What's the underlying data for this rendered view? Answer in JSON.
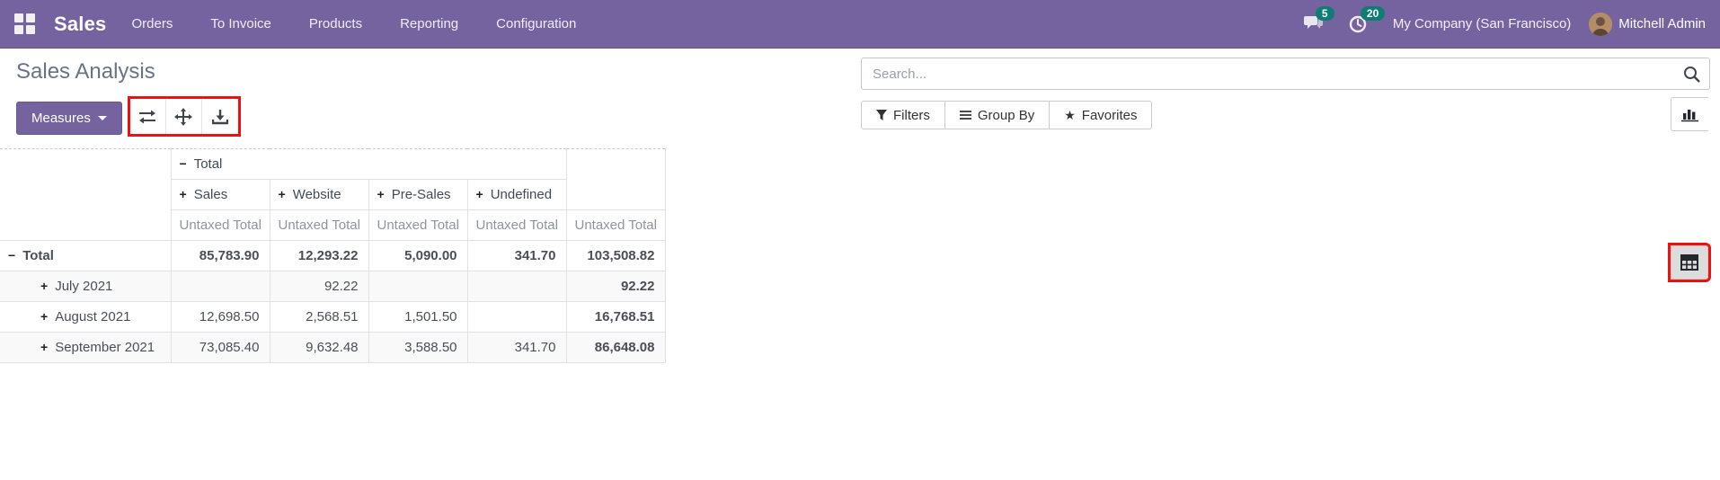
{
  "navbar": {
    "brand": "Sales",
    "menu": [
      "Orders",
      "To Invoice",
      "Products",
      "Reporting",
      "Configuration"
    ],
    "messages_badge": "5",
    "activities_badge": "20",
    "company": "My Company (San Francisco)",
    "user": "Mitchell Admin"
  },
  "page": {
    "title": "Sales Analysis",
    "measures_label": "Measures"
  },
  "search": {
    "placeholder": "Search..."
  },
  "filter_bar": {
    "filters": "Filters",
    "group_by": "Group By",
    "favorites": "Favorites"
  },
  "icons": {
    "apps": "apps-grid-icon",
    "messages": "chat-bubbles-icon",
    "activities": "clock-icon",
    "flip_axis": "flip-axis-icon",
    "expand_all": "expand-icon",
    "download": "download-icon",
    "search": "magnifier-icon",
    "filter": "funnel-icon",
    "group": "list-icon",
    "favorite": "star-icon",
    "bar_view": "bar-chart-icon",
    "pivot_view": "pivot-grid-icon"
  },
  "colors": {
    "navbar": "#74639E",
    "badge": "#0E7D74",
    "highlight": "#EE1111",
    "title_text": "#6A7382"
  },
  "pivot": {
    "col_group": {
      "toggle": "−",
      "label": "Total"
    },
    "col_headers": [
      {
        "toggle": "+",
        "label": "Sales"
      },
      {
        "toggle": "+",
        "label": "Website"
      },
      {
        "toggle": "+",
        "label": "Pre-Sales"
      },
      {
        "toggle": "+",
        "label": "Undefined"
      }
    ],
    "measure": "Untaxed Total",
    "rows": [
      {
        "toggle": "−",
        "label": "Total",
        "values": [
          "85,783.90",
          "12,293.22",
          "5,090.00",
          "341.70",
          "103,508.82"
        ]
      },
      {
        "toggle": "+",
        "label": "July 2021",
        "values": [
          "",
          "92.22",
          "",
          "",
          "92.22"
        ]
      },
      {
        "toggle": "+",
        "label": "August 2021",
        "values": [
          "12,698.50",
          "2,568.51",
          "1,501.50",
          "",
          "16,768.51"
        ]
      },
      {
        "toggle": "+",
        "label": "September 2021",
        "values": [
          "73,085.40",
          "9,632.48",
          "3,588.50",
          "341.70",
          "86,648.08"
        ]
      }
    ]
  }
}
